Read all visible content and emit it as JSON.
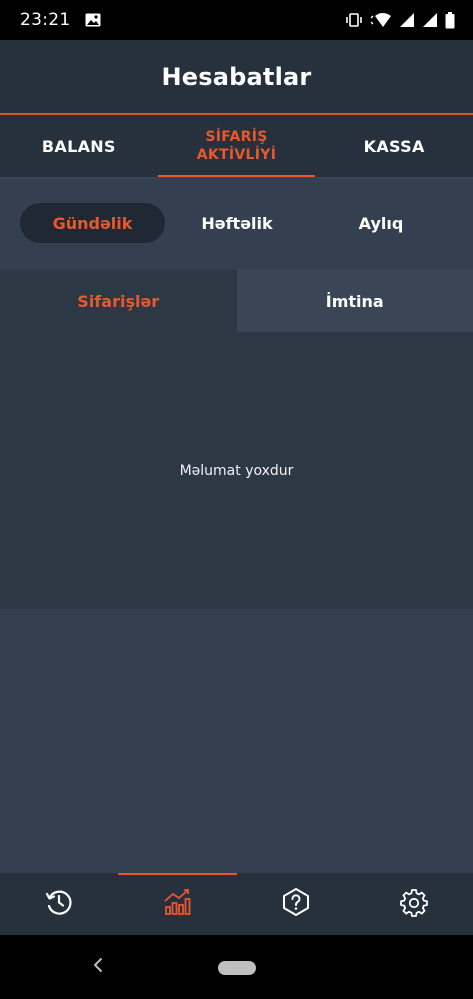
{
  "status_bar": {
    "time": "23:21"
  },
  "header": {
    "title": "Hesabatlar"
  },
  "top_tabs": [
    {
      "label": "BALANS"
    },
    {
      "label_line1": "SİFARİŞ",
      "label_line2": "AKTİVLİYİ"
    },
    {
      "label": "KASSA"
    }
  ],
  "periods": [
    {
      "label": "Gündəlik"
    },
    {
      "label": "Həftəlik"
    },
    {
      "label": "Aylıq"
    }
  ],
  "sub_tabs": [
    {
      "label": "Sifarişlər"
    },
    {
      "label": "İmtina"
    }
  ],
  "empty_state": {
    "message": "Məlumat yoxdur"
  },
  "colors": {
    "accent": "#e8582c",
    "background_dark": "#27303d",
    "content_bg": "#34404f"
  },
  "bottom_nav": [
    {
      "icon": "history-icon"
    },
    {
      "icon": "chart-icon"
    },
    {
      "icon": "help-icon"
    },
    {
      "icon": "settings-icon"
    }
  ]
}
